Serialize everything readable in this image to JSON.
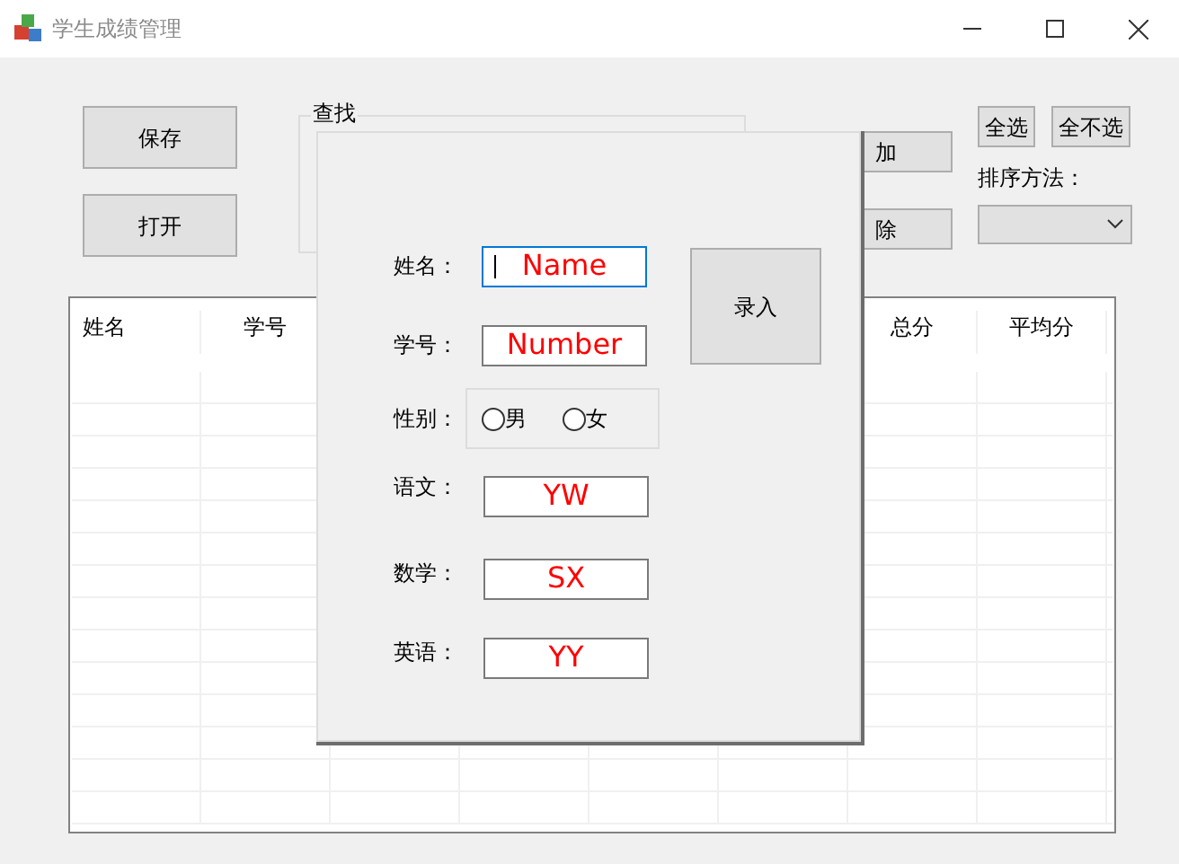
{
  "window": {
    "title": "学生成绩管理"
  },
  "left_buttons": [
    "保存",
    "打开"
  ],
  "search_group": {
    "title": "查找"
  },
  "action_buttons": [
    "加",
    "除"
  ],
  "select_buttons": [
    "全选",
    "全不选"
  ],
  "sort": {
    "label": "排序方法："
  },
  "table": {
    "columns_left": [
      "姓名",
      "学号"
    ],
    "columns_right": [
      "总分",
      "平均分"
    ]
  },
  "dialog": {
    "fields": [
      {
        "kind": "text",
        "label": "姓名：",
        "value": "Name",
        "focused": true
      },
      {
        "kind": "text",
        "label": "学号：",
        "value": "Number",
        "focused": false
      },
      {
        "kind": "radio",
        "label": "性别：",
        "options": [
          {
            "label": "男",
            "selected": false
          },
          {
            "label": "女",
            "selected": false
          }
        ]
      },
      {
        "kind": "text",
        "label": "语文：",
        "value": "YW",
        "focused": false
      },
      {
        "kind": "text",
        "label": "数学：",
        "value": "SX",
        "focused": false
      },
      {
        "kind": "text",
        "label": "英语：",
        "value": "YY",
        "focused": false
      }
    ],
    "submit": "录入"
  }
}
